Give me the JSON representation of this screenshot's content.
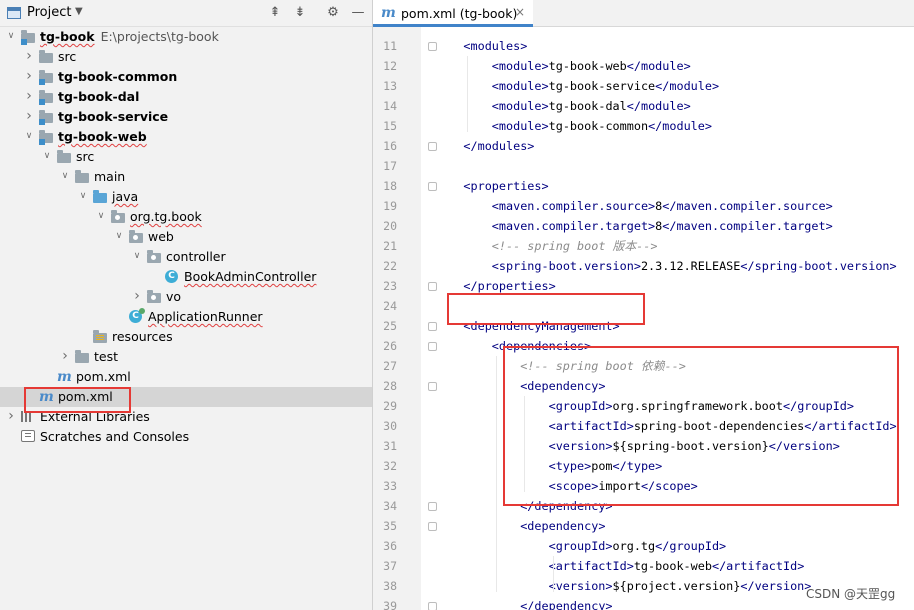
{
  "project_panel": {
    "title": "Project",
    "toolbar_icons": [
      "expand-all-icon",
      "collapse-all-icon",
      "gear-icon",
      "hide-icon"
    ],
    "tree": [
      {
        "label": "tg-book",
        "path": "E:\\projects\\tg-book",
        "icon": "module-folder-icon",
        "depth": 0,
        "arrow": "expanded",
        "bold": true
      },
      {
        "label": "src",
        "icon": "folder-icon",
        "depth": 1,
        "arrow": "collapsed"
      },
      {
        "label": "tg-book-common",
        "icon": "module-folder-icon",
        "depth": 1,
        "arrow": "collapsed",
        "bold": true
      },
      {
        "label": "tg-book-dal",
        "icon": "module-folder-icon",
        "depth": 1,
        "arrow": "collapsed",
        "bold": true
      },
      {
        "label": "tg-book-service",
        "icon": "module-folder-icon",
        "depth": 1,
        "arrow": "collapsed",
        "bold": true
      },
      {
        "label": "tg-book-web",
        "icon": "module-folder-icon",
        "depth": 1,
        "arrow": "expanded",
        "bold": true
      },
      {
        "label": "src",
        "icon": "folder-icon",
        "depth": 2,
        "arrow": "expanded"
      },
      {
        "label": "main",
        "icon": "folder-icon",
        "depth": 3,
        "arrow": "expanded"
      },
      {
        "label": "java",
        "icon": "source-folder-icon",
        "depth": 4,
        "arrow": "expanded"
      },
      {
        "label": "org.tg.book",
        "icon": "package-icon",
        "depth": 5,
        "arrow": "expanded"
      },
      {
        "label": "web",
        "icon": "package-icon",
        "depth": 6,
        "arrow": "expanded"
      },
      {
        "label": "controller",
        "icon": "package-icon",
        "depth": 7,
        "arrow": "expanded"
      },
      {
        "label": "BookAdminController",
        "icon": "class-icon",
        "depth": 8,
        "arrow": "none"
      },
      {
        "label": "vo",
        "icon": "package-icon",
        "depth": 7,
        "arrow": "collapsed"
      },
      {
        "label": "ApplicationRunner",
        "icon": "runnable-class-icon",
        "depth": 6,
        "arrow": "none"
      },
      {
        "label": "resources",
        "icon": "resources-folder-icon",
        "depth": 4,
        "arrow": "none"
      },
      {
        "label": "test",
        "icon": "folder-icon",
        "depth": 3,
        "arrow": "collapsed"
      },
      {
        "label": "pom.xml",
        "icon": "maven-icon",
        "depth": 2,
        "arrow": "none"
      },
      {
        "label": "pom.xml",
        "icon": "maven-icon",
        "depth": 1,
        "arrow": "none",
        "selected": true
      },
      {
        "label": "External Libraries",
        "icon": "libraries-icon",
        "depth": 0,
        "arrow": "collapsed"
      },
      {
        "label": "Scratches and Consoles",
        "icon": "scratches-icon",
        "depth": 0,
        "arrow": "none"
      }
    ]
  },
  "editor": {
    "tab": {
      "label": "pom.xml (tg-book)",
      "close": "×"
    },
    "lines": [
      {
        "n": "11",
        "indent": 1,
        "parts": [
          [
            "tag",
            "<modules>"
          ]
        ]
      },
      {
        "n": "12",
        "indent": 2,
        "parts": [
          [
            "tag",
            "<module>"
          ],
          [
            "tx",
            "tg-book-web"
          ],
          [
            "tag",
            "</module>"
          ]
        ]
      },
      {
        "n": "13",
        "indent": 2,
        "parts": [
          [
            "tag",
            "<module>"
          ],
          [
            "tx",
            "tg-book-service"
          ],
          [
            "tag",
            "</module>"
          ]
        ]
      },
      {
        "n": "14",
        "indent": 2,
        "parts": [
          [
            "tag",
            "<module>"
          ],
          [
            "tx",
            "tg-book-dal"
          ],
          [
            "tag",
            "</module>"
          ]
        ]
      },
      {
        "n": "15",
        "indent": 2,
        "parts": [
          [
            "tag",
            "<module>"
          ],
          [
            "tx",
            "tg-book-common"
          ],
          [
            "tag",
            "</module>"
          ]
        ]
      },
      {
        "n": "16",
        "indent": 1,
        "parts": [
          [
            "tag",
            "</modules>"
          ]
        ]
      },
      {
        "n": "17",
        "indent": 0,
        "parts": []
      },
      {
        "n": "18",
        "indent": 1,
        "parts": [
          [
            "tag",
            "<properties>"
          ]
        ]
      },
      {
        "n": "19",
        "indent": 2,
        "parts": [
          [
            "tag",
            "<maven.compiler.source>"
          ],
          [
            "tx",
            "8"
          ],
          [
            "tag",
            "</maven.compiler.source>"
          ]
        ]
      },
      {
        "n": "20",
        "indent": 2,
        "parts": [
          [
            "tag",
            "<maven.compiler.target>"
          ],
          [
            "tx",
            "8"
          ],
          [
            "tag",
            "</maven.compiler.target>"
          ]
        ]
      },
      {
        "n": "21",
        "indent": 2,
        "parts": [
          [
            "cm",
            "<!-- spring boot 版本-->"
          ]
        ]
      },
      {
        "n": "22",
        "indent": 2,
        "parts": [
          [
            "tag",
            "<spring-boot.version>"
          ],
          [
            "tx",
            "2.3.12.RELEASE"
          ],
          [
            "tag",
            "</spring-boot.version>"
          ]
        ]
      },
      {
        "n": "23",
        "indent": 1,
        "parts": [
          [
            "tag",
            "</properties>"
          ]
        ]
      },
      {
        "n": "24",
        "indent": 0,
        "parts": []
      },
      {
        "n": "25",
        "indent": 1,
        "parts": [
          [
            "tag",
            "<dependencyManagement>"
          ]
        ]
      },
      {
        "n": "26",
        "indent": 2,
        "parts": [
          [
            "tag",
            "<dependencies>"
          ]
        ]
      },
      {
        "n": "27",
        "indent": 3,
        "parts": [
          [
            "cm",
            "<!-- spring boot 依赖-->"
          ]
        ]
      },
      {
        "n": "28",
        "indent": 3,
        "parts": [
          [
            "tag",
            "<dependency>"
          ]
        ]
      },
      {
        "n": "29",
        "indent": 4,
        "parts": [
          [
            "tag",
            "<groupId>"
          ],
          [
            "tx",
            "org.springframework.boot"
          ],
          [
            "tag",
            "</groupId>"
          ]
        ]
      },
      {
        "n": "30",
        "indent": 4,
        "parts": [
          [
            "tag",
            "<artifactId>"
          ],
          [
            "tx",
            "spring-boot-dependencies"
          ],
          [
            "tag",
            "</artifactId>"
          ]
        ]
      },
      {
        "n": "31",
        "indent": 4,
        "parts": [
          [
            "tag",
            "<version>"
          ],
          [
            "tx",
            "${spring-boot.version}"
          ],
          [
            "tag",
            "</version>"
          ]
        ]
      },
      {
        "n": "32",
        "indent": 4,
        "parts": [
          [
            "tag",
            "<type>"
          ],
          [
            "tx",
            "pom"
          ],
          [
            "tag",
            "</type>"
          ]
        ]
      },
      {
        "n": "33",
        "indent": 4,
        "parts": [
          [
            "tag",
            "<scope>"
          ],
          [
            "tx",
            "import"
          ],
          [
            "tag",
            "</scope>"
          ]
        ]
      },
      {
        "n": "34",
        "indent": 3,
        "parts": [
          [
            "tag",
            "</dependency>"
          ]
        ]
      },
      {
        "n": "35",
        "indent": 3,
        "parts": [
          [
            "tag",
            "<dependency>"
          ]
        ]
      },
      {
        "n": "36",
        "indent": 4,
        "parts": [
          [
            "tag",
            "<groupId>"
          ],
          [
            "tx",
            "org.tg"
          ],
          [
            "tag",
            "</groupId>"
          ]
        ]
      },
      {
        "n": "37",
        "indent": 4,
        "parts": [
          [
            "tag",
            "<artifactId>"
          ],
          [
            "tx",
            "tg-book-web"
          ],
          [
            "tag",
            "</artifactId>"
          ]
        ]
      },
      {
        "n": "38",
        "indent": 4,
        "parts": [
          [
            "tag",
            "<version>"
          ],
          [
            "tx",
            "${project.version}"
          ],
          [
            "tag",
            "</version>"
          ]
        ]
      },
      {
        "n": "39",
        "indent": 3,
        "parts": [
          [
            "tag",
            "</dependency>"
          ]
        ]
      }
    ]
  },
  "watermark": "CSDN @天罡gg",
  "colors": {
    "highlight_box": "#e53935",
    "xml_tag": "#000080",
    "comment": "#8c8c8c",
    "selection": "#d5d5d5"
  }
}
